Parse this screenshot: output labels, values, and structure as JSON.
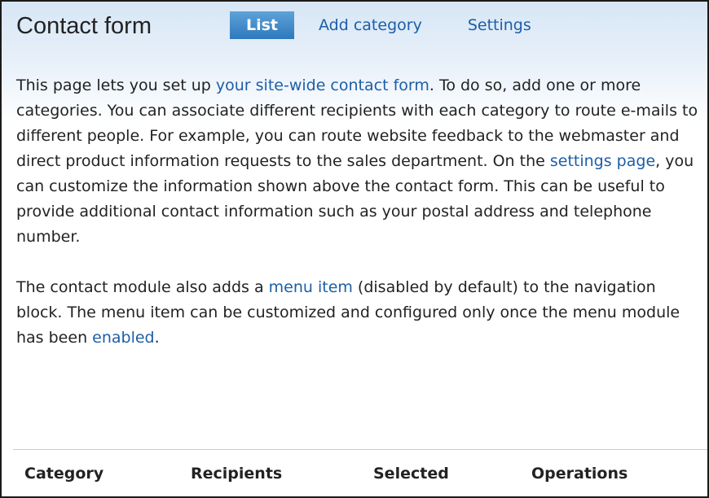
{
  "header": {
    "title": "Contact form",
    "tabs": [
      {
        "label": "List",
        "active": true
      },
      {
        "label": "Add category",
        "active": false
      },
      {
        "label": "Settings",
        "active": false
      }
    ]
  },
  "intro": {
    "p1_a": "This page lets you set up ",
    "p1_link1": "your site-wide contact form",
    "p1_b": ". To do so, add one or more categories. You can associate different recipients with each category to route e-mails to different people. For example, you can route website feedback to the webmaster and direct product information requests to the sales department. On the ",
    "p1_link2": "settings page",
    "p1_c": ", you can customize the information shown above the contact form. This can be useful to provide additional contact information such as your postal address and telephone number.",
    "p2_a": "The contact module also adds a ",
    "p2_link1": "menu item",
    "p2_b": " (disabled by default) to the navigation block. The menu item can be customized and configured only once the menu module has been ",
    "p2_link2": "enabled",
    "p2_c": "."
  },
  "table": {
    "columns": [
      "Category",
      "Recipients",
      "Selected",
      "Operations"
    ]
  },
  "colors": {
    "link": "#1c5ea8",
    "active_tab": "#3a86c8",
    "header_bg": "#d7e6f5",
    "table_rule": "#b8d0e8"
  }
}
